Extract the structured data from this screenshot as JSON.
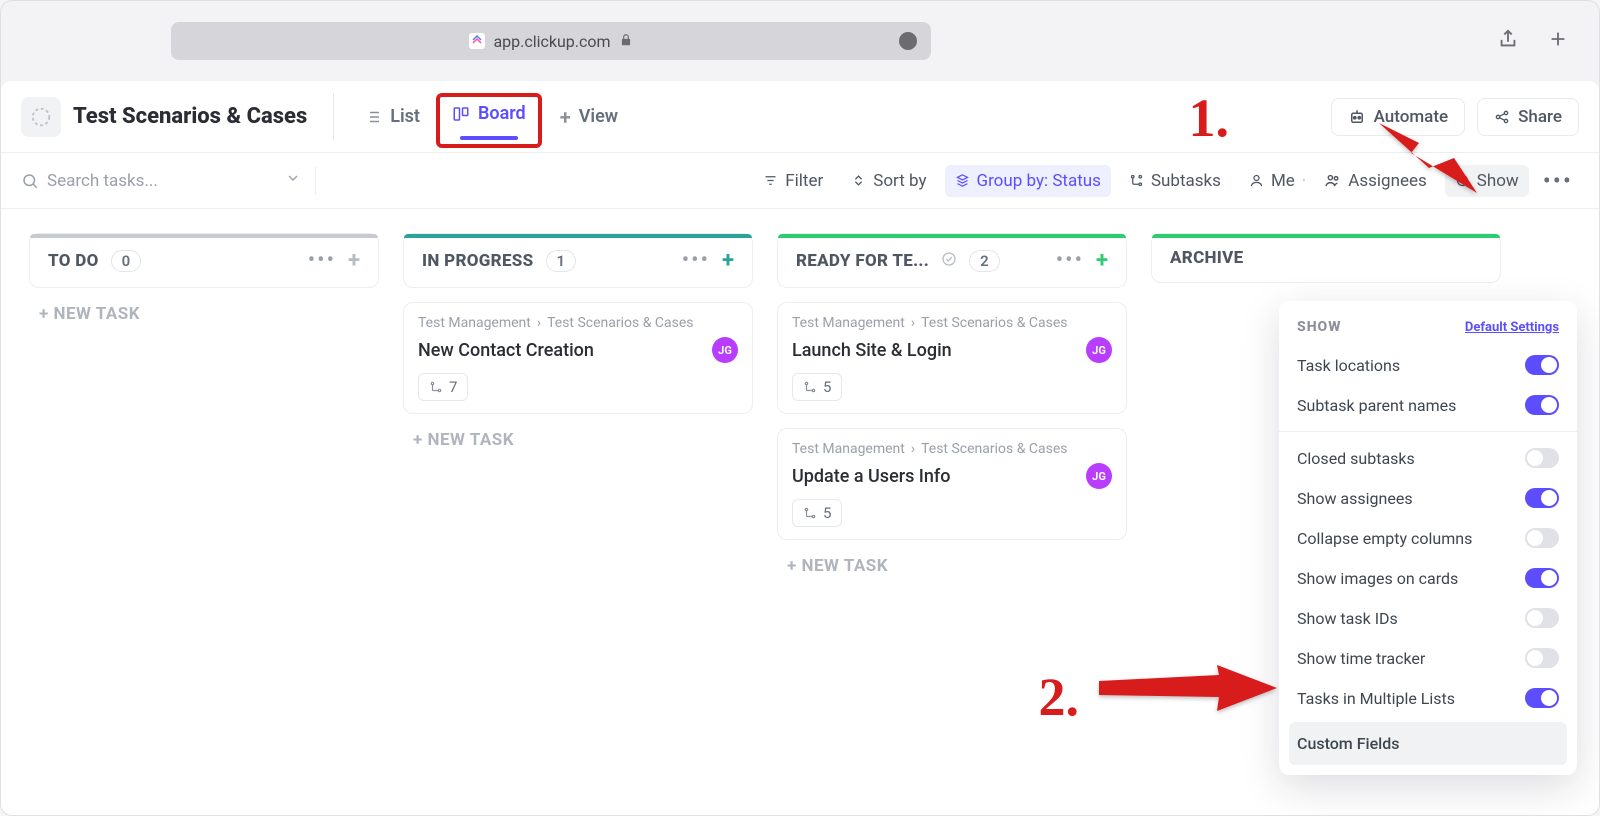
{
  "browser": {
    "url": "app.clickup.com"
  },
  "header": {
    "page_title": "Test Scenarios & Cases",
    "views": {
      "list": "List",
      "board": "Board",
      "add": "View"
    },
    "automate": "Automate",
    "share": "Share"
  },
  "toolbar": {
    "search_placeholder": "Search tasks...",
    "filter": "Filter",
    "sort": "Sort by",
    "group": "Group by: Status",
    "subtasks": "Subtasks",
    "me": "Me",
    "assignees": "Assignees",
    "show": "Show"
  },
  "columns": [
    {
      "title": "TO DO",
      "count": "0",
      "accent": "#c7cad0",
      "add_color": "#b7bbc2",
      "cards": []
    },
    {
      "title": "IN PROGRESS",
      "count": "1",
      "accent": "#2aa39a",
      "add_color": "#2aa39a",
      "cards": [
        {
          "parent": "Test Management",
          "list": "Test Scenarios & Cases",
          "title": "New Contact Creation",
          "assignee": "JG",
          "subtasks": "7"
        }
      ]
    },
    {
      "title": "READY FOR TE...",
      "count": "2",
      "accent": "#2ecc71",
      "add_color": "#2ecc71",
      "check": true,
      "cards": [
        {
          "parent": "Test Management",
          "list": "Test Scenarios & Cases",
          "title": "Launch Site & Login",
          "assignee": "JG",
          "subtasks": "5"
        },
        {
          "parent": "Test Management",
          "list": "Test Scenarios & Cases",
          "title": "Update a Users Info",
          "assignee": "JG",
          "subtasks": "5"
        }
      ]
    },
    {
      "title": "ARCHIVE",
      "count": "",
      "accent": "#2ecc71",
      "add_color": "#2ecc71",
      "truncated": true,
      "cards": []
    }
  ],
  "new_task_label": "+ NEW TASK",
  "show_panel": {
    "title": "SHOW",
    "reset": "Default Settings",
    "group1": [
      {
        "label": "Task locations",
        "on": true
      },
      {
        "label": "Subtask parent names",
        "on": true
      }
    ],
    "group2": [
      {
        "label": "Closed subtasks",
        "on": false
      },
      {
        "label": "Show assignees",
        "on": true
      },
      {
        "label": "Collapse empty columns",
        "on": false
      },
      {
        "label": "Show images on cards",
        "on": true
      },
      {
        "label": "Show task IDs",
        "on": false
      },
      {
        "label": "Show time tracker",
        "on": false
      },
      {
        "label": "Tasks in Multiple Lists",
        "on": true
      }
    ],
    "custom_fields": "Custom Fields"
  },
  "annotations": {
    "one": "1.",
    "two": "2."
  }
}
